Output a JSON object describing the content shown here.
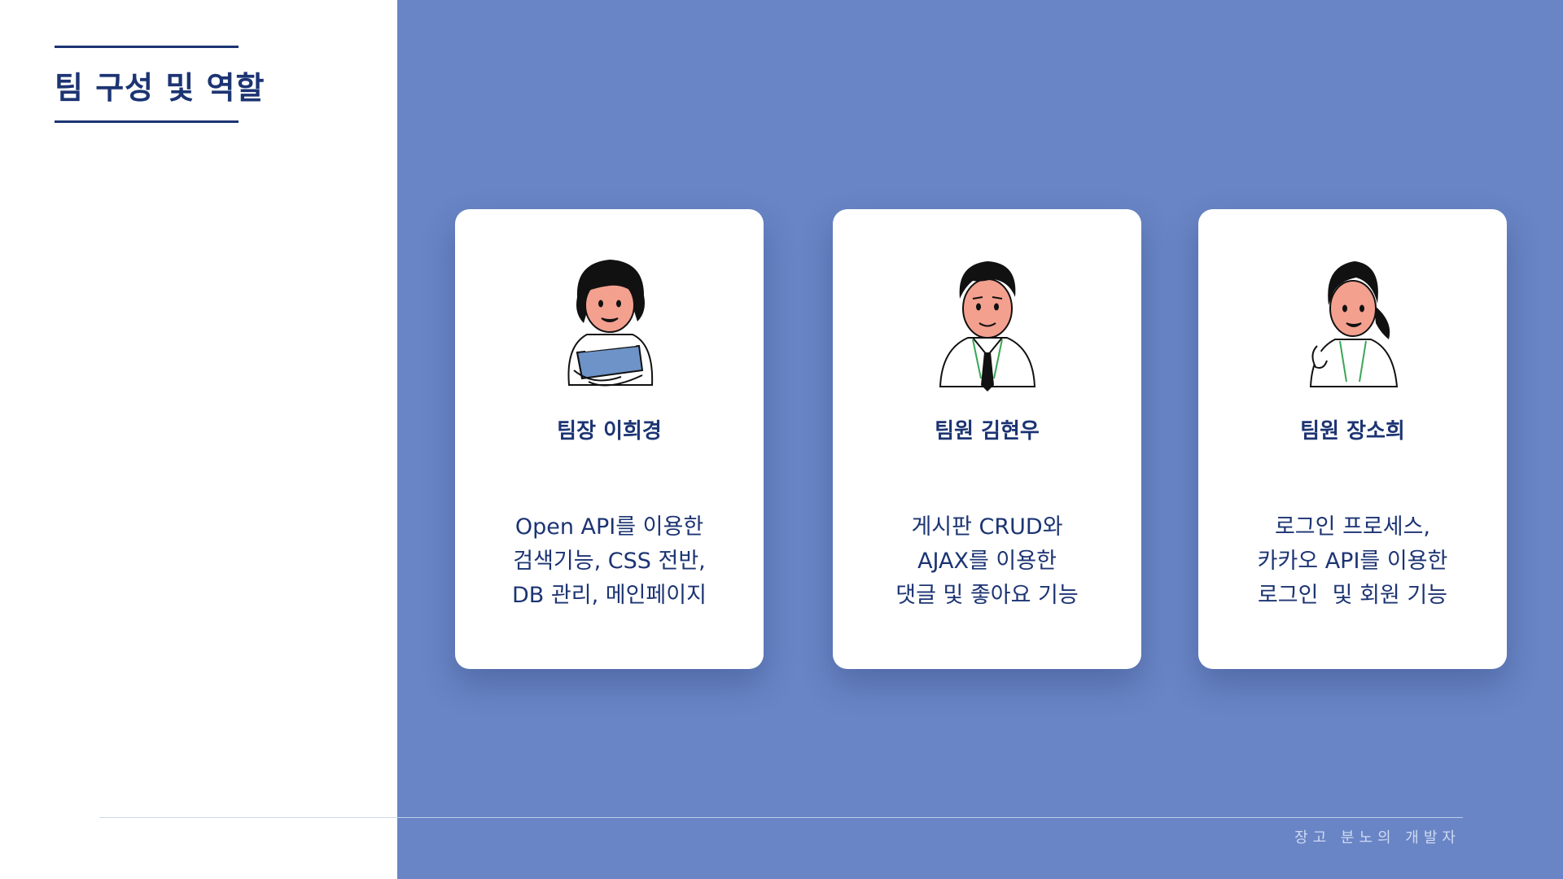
{
  "colors": {
    "panel": "#6985c5",
    "navy": "#1c3473",
    "card": "#ffffff"
  },
  "header": {
    "title": "팀 구성 및 역할"
  },
  "members": [
    {
      "name": "팀장 이희경",
      "avatar_icon": "woman-holding-book-icon",
      "role_lines": [
        "Open API를 이용한",
        "검색기능, CSS 전반,",
        "DB 관리, 메인페이지"
      ]
    },
    {
      "name": "팀원 김현우",
      "avatar_icon": "man-with-tie-icon",
      "role_lines": [
        "게시판 CRUD와",
        "AJAX를 이용한",
        "댓글 및 좋아요 기능"
      ]
    },
    {
      "name": "팀원 장소희",
      "avatar_icon": "woman-with-ponytail-icon",
      "role_lines": [
        "로그인 프로세스,",
        "카카오 API를 이용한",
        "로그인  및 회원 기능"
      ]
    }
  ],
  "footer": {
    "text": "장고 분노의 개발자"
  }
}
